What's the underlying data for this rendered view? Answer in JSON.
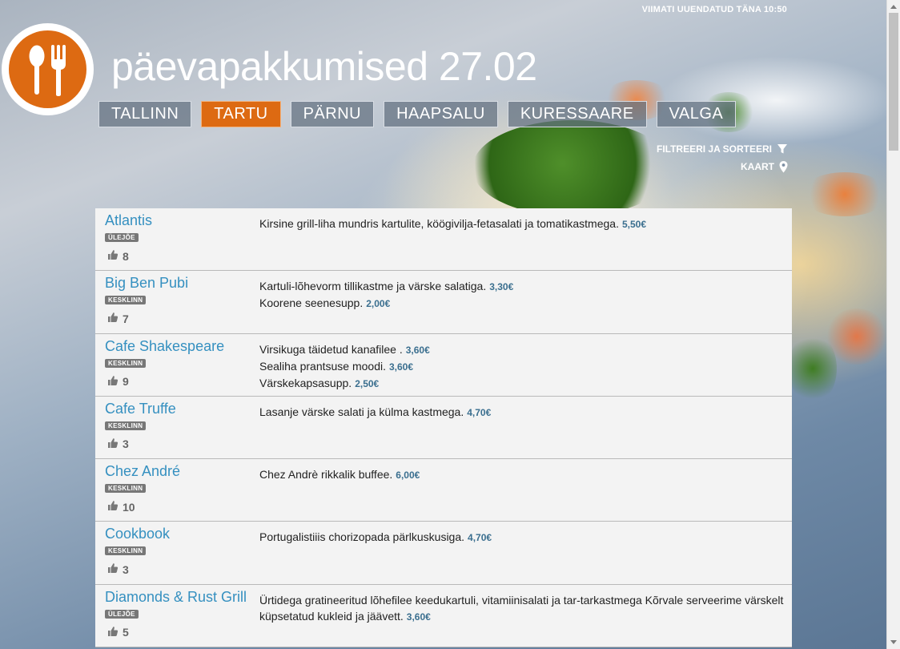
{
  "header": {
    "last_updated": "VIIMATI UUENDATUD TÄNA 10:50",
    "title": "päevapakkumised 27.02"
  },
  "cities": [
    {
      "label": "TALLINN",
      "active": false
    },
    {
      "label": "TARTU",
      "active": true
    },
    {
      "label": "PÄRNU",
      "active": false
    },
    {
      "label": "HAAPSALU",
      "active": false
    },
    {
      "label": "KURESSAARE",
      "active": false
    },
    {
      "label": "VALGA",
      "active": false
    }
  ],
  "links": {
    "filter": "FILTREERI JA SORTEERI",
    "map": "KAART"
  },
  "colors": {
    "accent": "#dd6a12",
    "link": "#3590c0",
    "price": "#3b6f8f"
  },
  "restaurants": [
    {
      "name": "Atlantis",
      "area": "ÜLEJÕE",
      "likes": "8",
      "dishes": [
        {
          "text": "Kirsine grill-liha mundris kartulite, köögivilja-fetasalati ja tomatikastmega.",
          "price": "5,50€"
        }
      ]
    },
    {
      "name": "Big Ben Pubi",
      "area": "KESKLINN",
      "likes": "7",
      "dishes": [
        {
          "text": "Kartuli-lõhevorm tillikastme ja värske salatiga.",
          "price": "3,30€"
        },
        {
          "text": "Koorene seenesupp.",
          "price": "2,00€"
        }
      ]
    },
    {
      "name": "Cafe Shakespeare",
      "area": "KESKLINN",
      "likes": "9",
      "dishes": [
        {
          "text": "Virsikuga täidetud kanafilee  .",
          "price": "3,60€"
        },
        {
          "text": "Sealiha prantsuse moodi.",
          "price": "3,60€"
        },
        {
          "text": "Värskekapsasupp.",
          "price": "2,50€"
        }
      ]
    },
    {
      "name": "Cafe Truffe",
      "area": "KESKLINN",
      "likes": "3",
      "dishes": [
        {
          "text": "Lasanje värske salati ja külma kastmega.",
          "price": "4,70€"
        }
      ]
    },
    {
      "name": "Chez André",
      "area": "KESKLINN",
      "likes": "10",
      "dishes": [
        {
          "text": "Chez Andrè rikkalik buffee.",
          "price": "6,00€"
        }
      ]
    },
    {
      "name": "Cookbook",
      "area": "KESKLINN",
      "likes": "3",
      "dishes": [
        {
          "text": "Portugalistiiis chorizopada pärlkuskusiga.",
          "price": "4,70€"
        }
      ]
    },
    {
      "name": "Diamonds & Rust Grill",
      "area": "ÜLEJÕE",
      "likes": "5",
      "dishes": [
        {
          "text": "Ürtidega gratineeritud lõhefilee keedukartuli, vitamiinisalati ja tar-tarkastmega Kõrvale serveerime värskelt küpsetatud kukleid ja jäävett.",
          "price": "3,60€"
        }
      ]
    }
  ]
}
